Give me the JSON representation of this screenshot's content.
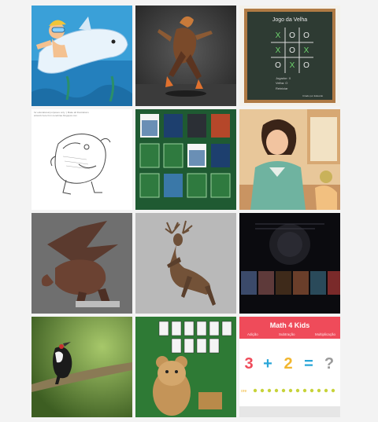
{
  "gallery": {
    "tiles": [
      {
        "subject": "cartoon boy riding dolphin underwater"
      },
      {
        "subject": "3d animated character dancing"
      },
      {
        "subject": "tic tac toe chalkboard game",
        "title": "Jogo da Velha",
        "board": [
          "X",
          "O",
          "O",
          "X",
          "O",
          "X",
          "O",
          "X",
          "O"
        ],
        "lines": [
          "Jogador: X",
          "Velha: O",
          "Reiniciar"
        ],
        "footer": "Criado por Eduardo"
      },
      {
        "subject": "pencil sketch of animal",
        "caption_lines": [
          "for educational purposes only :) Make all illustrations",
          "artwork here from tenebrae.blogspot.com"
        ]
      },
      {
        "subject": "memory card game with movie posters"
      },
      {
        "subject": "3d animated woman in shop"
      },
      {
        "subject": "3d dragon model"
      },
      {
        "subject": "3d deer model rearing"
      },
      {
        "subject": "dark movie streaming interface"
      },
      {
        "subject": "woodpecker on branch"
      },
      {
        "subject": "cartoon bear solitaire game"
      },
      {
        "subject": "math game for kids",
        "title": "Math 4 Kids",
        "tabs": [
          "Adição",
          "Subtração",
          "Multiplicação"
        ],
        "equation": {
          "a": "3",
          "op": "+",
          "b": "2",
          "eq": "=",
          "ans": "?"
        },
        "footer_label": "ore"
      }
    ]
  },
  "colors": {
    "page_bg": "#f3f3f3",
    "math_red": "#ef4b5a",
    "chalk_green": "#2e3b33"
  }
}
